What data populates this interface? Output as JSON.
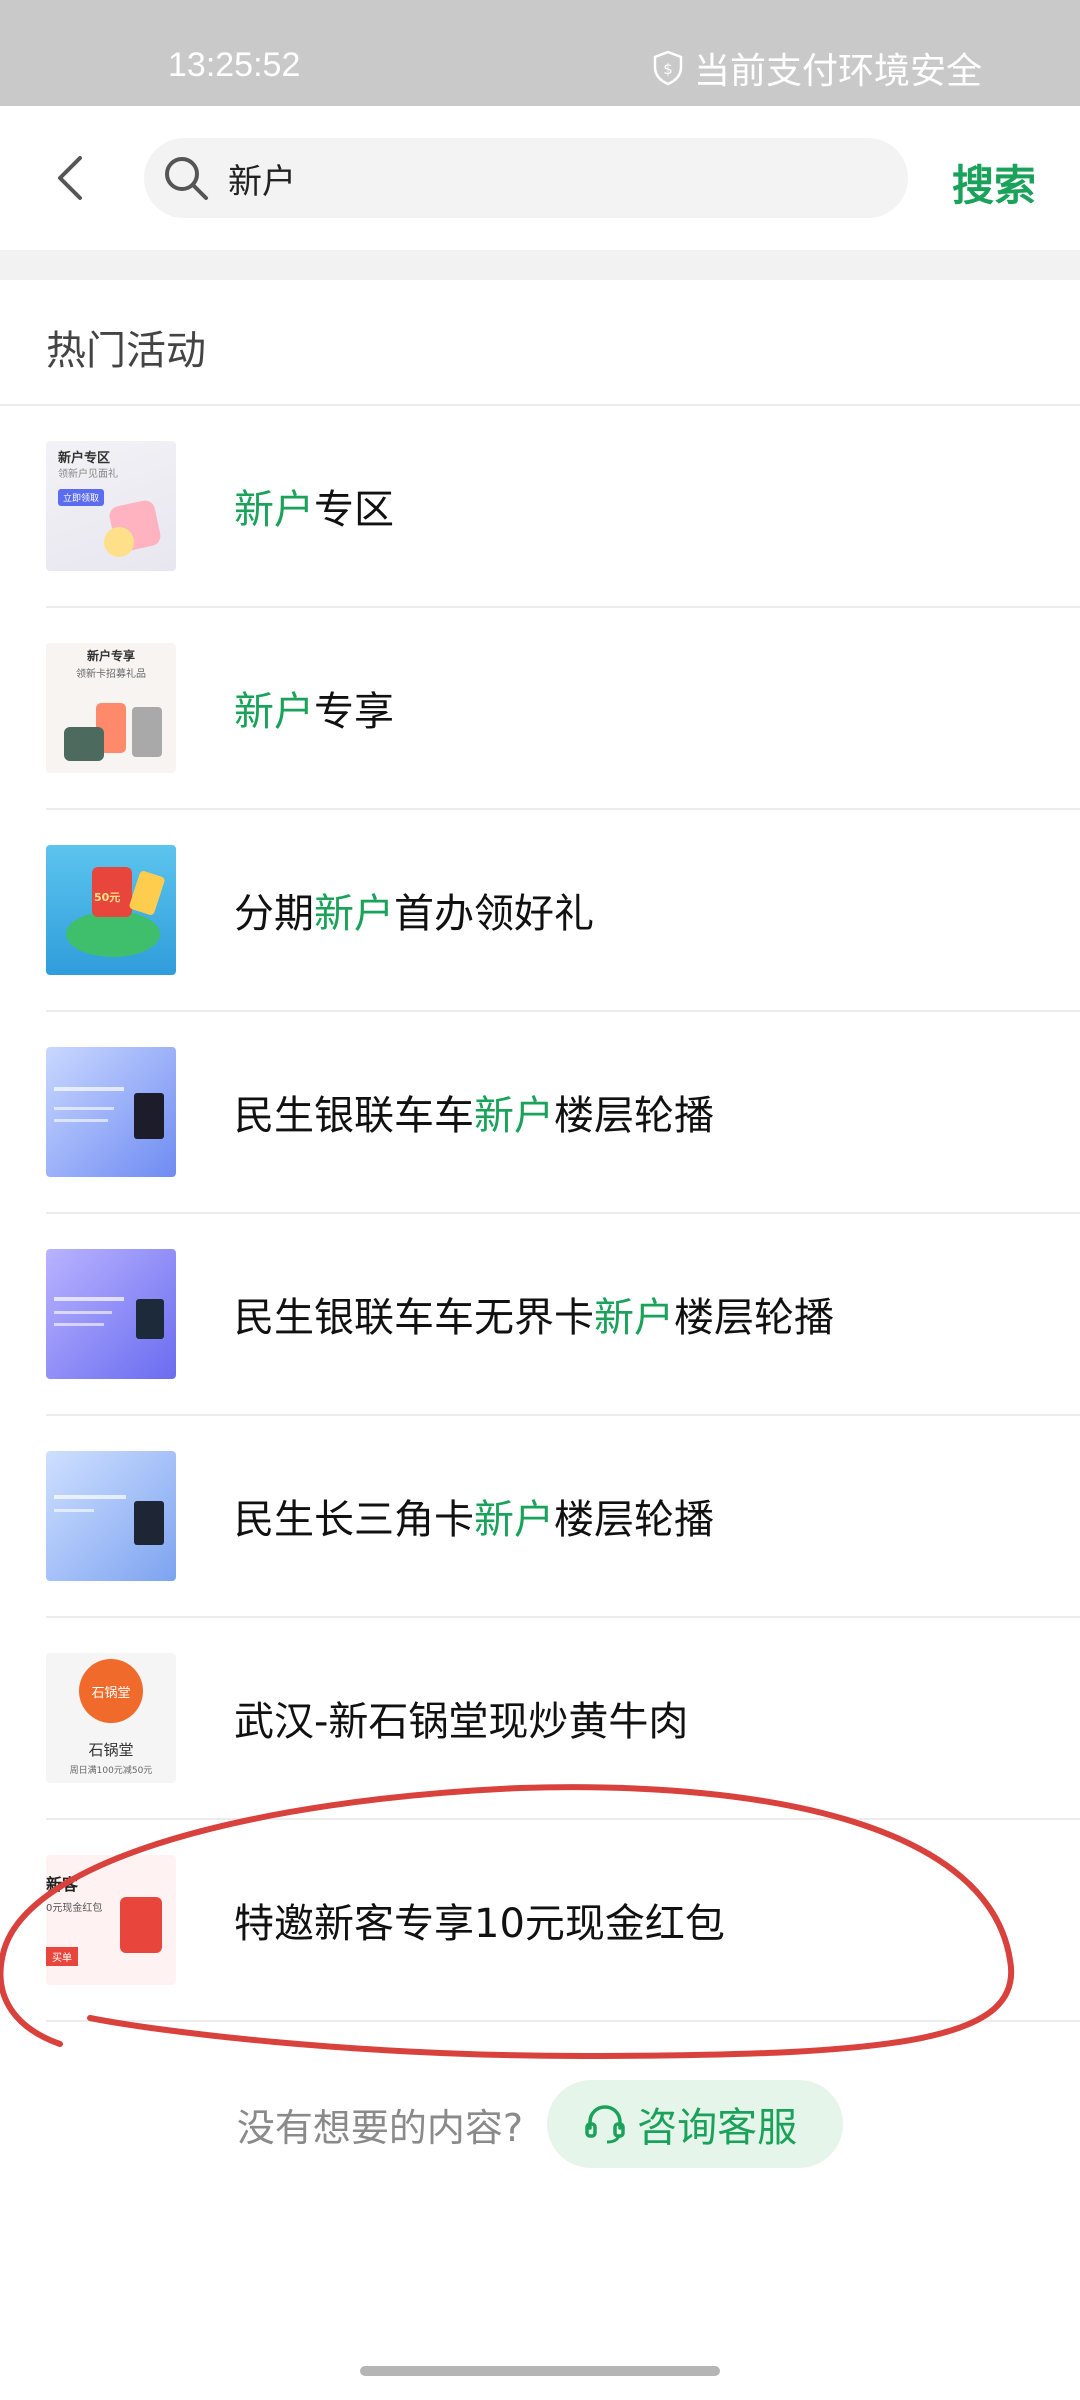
{
  "status_bar": {
    "time": "13:25:52",
    "security_text": "当前支付环境安全"
  },
  "search": {
    "query": "新户",
    "button": "搜索"
  },
  "section": {
    "title": "热门活动"
  },
  "items": [
    {
      "pre": "",
      "hl": "新户",
      "post": "专区",
      "thumb": {
        "l1": "新户专区",
        "l2": "领新户见面礼",
        "l3": "立即领取"
      }
    },
    {
      "pre": "",
      "hl": "新户",
      "post": "专享",
      "thumb": {
        "l1": "新户专享",
        "l2": "领新卡招募礼品"
      }
    },
    {
      "pre": "分期",
      "hl": "新户",
      "post": "首办领好礼",
      "thumb": {
        "l1": "50元"
      }
    },
    {
      "pre": "民生银联车车",
      "hl": "新户",
      "post": "楼层轮播"
    },
    {
      "pre": "民生银联车车无界卡",
      "hl": "新户",
      "post": "楼层轮播"
    },
    {
      "pre": "民生长三角卡",
      "hl": "新户",
      "post": "楼层轮播"
    },
    {
      "pre": "武汉-新石锅堂现炒黄牛肉",
      "hl": "",
      "post": "",
      "thumb": {
        "l1": "石锅堂",
        "l2": "石锅堂",
        "l3": "周日满100元减50元"
      }
    },
    {
      "pre": "特邀新客专享10元现金红包",
      "hl": "",
      "post": "",
      "thumb": {
        "l1": "新客",
        "l2": "0元现金红包",
        "l3": "买单"
      }
    }
  ],
  "footer": {
    "question": "没有想要的内容?",
    "cs_label": "咨询客服"
  },
  "colors": {
    "accent": "#1aa25a",
    "annotation": "#d9413d"
  }
}
